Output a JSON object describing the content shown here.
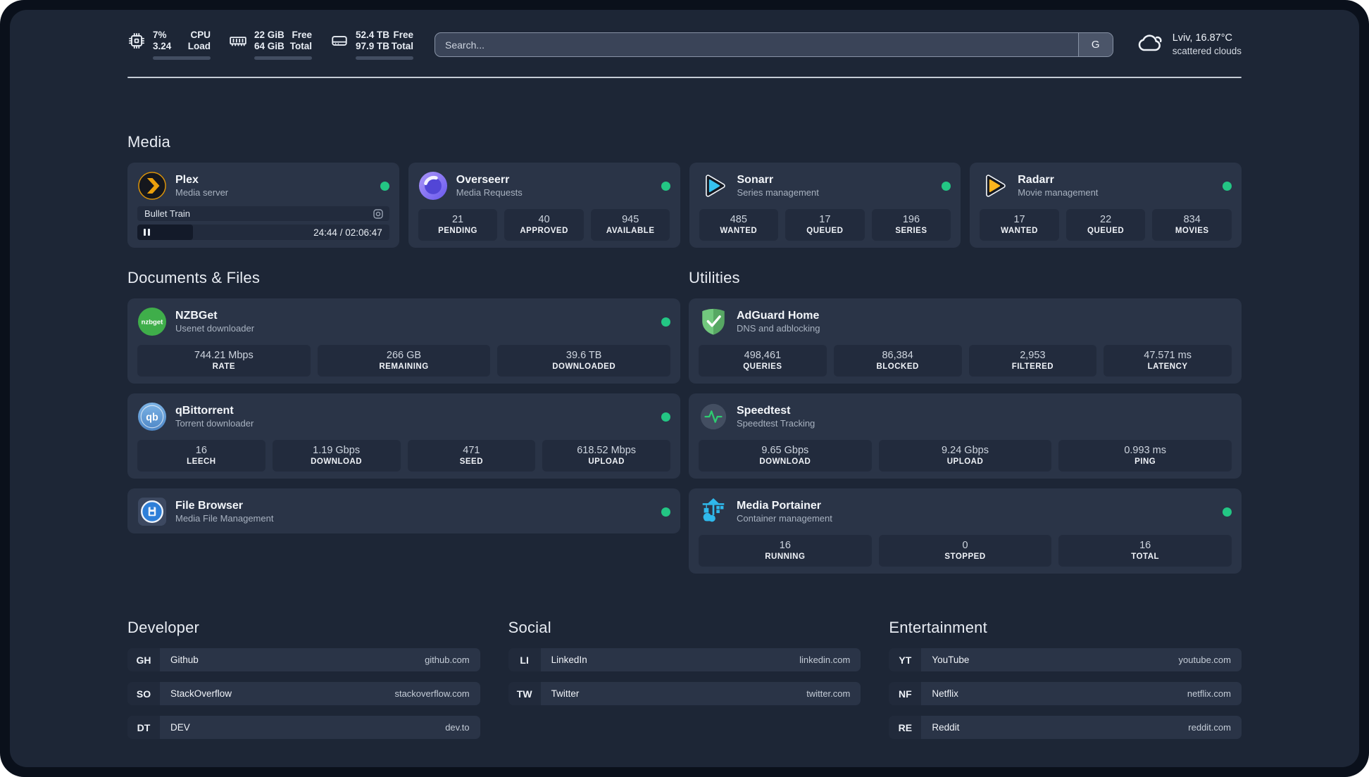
{
  "header": {
    "system_stats": [
      {
        "icon": "cpu-icon",
        "rows": [
          {
            "value": "7%",
            "label": "CPU"
          },
          {
            "value": "3.24",
            "label": "Load"
          }
        ],
        "progress": 7
      },
      {
        "icon": "ram-icon",
        "rows": [
          {
            "value": "22 GiB",
            "label": "Free"
          },
          {
            "value": "64 GiB",
            "label": "Total"
          }
        ],
        "progress": 66
      },
      {
        "icon": "disk-icon",
        "rows": [
          {
            "value": "52.4 TB",
            "label": "Free"
          },
          {
            "value": "97.9 TB",
            "label": "Total"
          }
        ],
        "progress": 46
      }
    ],
    "search": {
      "placeholder": "Search...",
      "engine_button": "G"
    },
    "weather": {
      "location": "Lviv, 16.87°C",
      "condition": "scattered clouds"
    }
  },
  "sections": {
    "media": {
      "title": "Media",
      "plex": {
        "name": "Plex",
        "description": "Media server",
        "now_playing": {
          "title": "Bullet Train",
          "time_display": "24:44 / 02:06:47",
          "progress": 19.5
        }
      },
      "overseerr": {
        "name": "Overseerr",
        "description": "Media Requests",
        "stats": [
          {
            "value": "21",
            "label": "PENDING"
          },
          {
            "value": "40",
            "label": "APPROVED"
          },
          {
            "value": "945",
            "label": "AVAILABLE"
          }
        ]
      },
      "sonarr": {
        "name": "Sonarr",
        "description": "Series management",
        "stats": [
          {
            "value": "485",
            "label": "WANTED"
          },
          {
            "value": "17",
            "label": "QUEUED"
          },
          {
            "value": "196",
            "label": "SERIES"
          }
        ]
      },
      "radarr": {
        "name": "Radarr",
        "description": "Movie management",
        "stats": [
          {
            "value": "17",
            "label": "WANTED"
          },
          {
            "value": "22",
            "label": "QUEUED"
          },
          {
            "value": "834",
            "label": "MOVIES"
          }
        ]
      }
    },
    "documents": {
      "title": "Documents & Files",
      "nzbget": {
        "name": "NZBGet",
        "description": "Usenet downloader",
        "icon_text": "nzbget",
        "stats": [
          {
            "value": "744.21 Mbps",
            "label": "RATE"
          },
          {
            "value": "266 GB",
            "label": "REMAINING"
          },
          {
            "value": "39.6 TB",
            "label": "DOWNLOADED"
          }
        ]
      },
      "qbittorrent": {
        "name": "qBittorrent",
        "description": "Torrent downloader",
        "icon_text": "qb",
        "stats": [
          {
            "value": "16",
            "label": "LEECH"
          },
          {
            "value": "1.19 Gbps",
            "label": "DOWNLOAD"
          },
          {
            "value": "471",
            "label": "SEED"
          },
          {
            "value": "618.52 Mbps",
            "label": "UPLOAD"
          }
        ]
      },
      "filebrowser": {
        "name": "File Browser",
        "description": "Media File Management"
      }
    },
    "utilities": {
      "title": "Utilities",
      "adguard": {
        "name": "AdGuard Home",
        "description": "DNS and adblocking",
        "stats": [
          {
            "value": "498,461",
            "label": "QUERIES"
          },
          {
            "value": "86,384",
            "label": "BLOCKED"
          },
          {
            "value": "2,953",
            "label": "FILTERED"
          },
          {
            "value": "47.571 ms",
            "label": "LATENCY"
          }
        ]
      },
      "speedtest": {
        "name": "Speedtest",
        "description": "Speedtest Tracking",
        "stats": [
          {
            "value": "9.65 Gbps",
            "label": "DOWNLOAD"
          },
          {
            "value": "9.24 Gbps",
            "label": "UPLOAD"
          },
          {
            "value": "0.993 ms",
            "label": "PING"
          }
        ]
      },
      "portainer": {
        "name": "Media Portainer",
        "description": "Container management",
        "stats": [
          {
            "value": "16",
            "label": "RUNNING"
          },
          {
            "value": "0",
            "label": "STOPPED"
          },
          {
            "value": "16",
            "label": "TOTAL"
          }
        ]
      }
    },
    "links": {
      "developer": {
        "title": "Developer",
        "items": [
          {
            "tag": "GH",
            "name": "Github",
            "url": "github.com"
          },
          {
            "tag": "SO",
            "name": "StackOverflow",
            "url": "stackoverflow.com"
          },
          {
            "tag": "DT",
            "name": "DEV",
            "url": "dev.to"
          }
        ]
      },
      "social": {
        "title": "Social",
        "items": [
          {
            "tag": "LI",
            "name": "LinkedIn",
            "url": "linkedin.com"
          },
          {
            "tag": "TW",
            "name": "Twitter",
            "url": "twitter.com"
          }
        ]
      },
      "entertainment": {
        "title": "Entertainment",
        "items": [
          {
            "tag": "YT",
            "name": "YouTube",
            "url": "youtube.com"
          },
          {
            "tag": "NF",
            "name": "Netflix",
            "url": "netflix.com"
          },
          {
            "tag": "RE",
            "name": "Reddit",
            "url": "reddit.com"
          }
        ]
      }
    }
  },
  "colors": {
    "status_online": "#23c684",
    "accent_green": "#2ecc71",
    "app_background": "#1d2636",
    "card_background": "#2a3447"
  }
}
